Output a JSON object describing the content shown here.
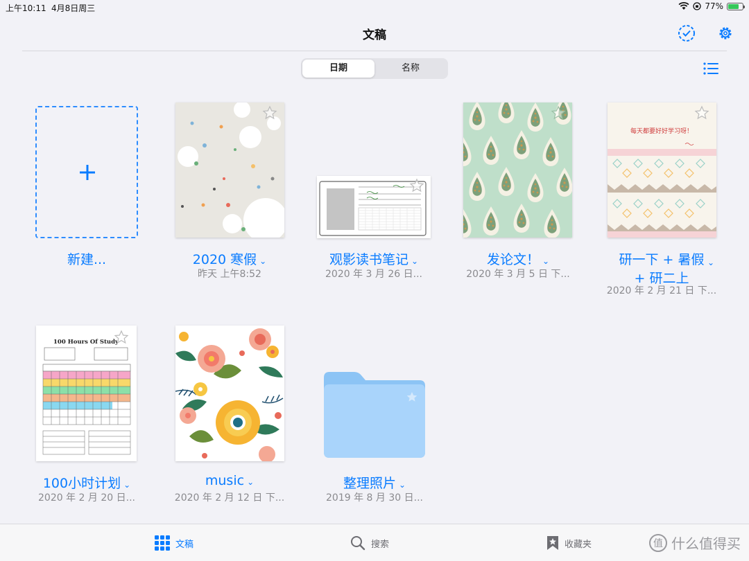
{
  "status": {
    "time": "上午10:11",
    "date": "4月8日周三",
    "battery": "77%",
    "battery_level": 0.77
  },
  "nav": {
    "title": "文稿"
  },
  "sort": {
    "options": [
      "日期",
      "名称"
    ],
    "selected": "日期"
  },
  "new_item": {
    "label": "新建..."
  },
  "documents": [
    {
      "name": "2020 寒假",
      "date": "昨天 上午8:52"
    },
    {
      "name": "观影读书笔记",
      "date": "2020 年 3 月 26 日..."
    },
    {
      "name": "发论文！",
      "date": "2020 年 3 月 5 日 下..."
    },
    {
      "name_line1": "研一下 + 暑假",
      "name_line2": "+ 研二上",
      "date": "2020 年 2 月 21 日 下..."
    },
    {
      "name": "100小时计划",
      "date": "2020 年 2 月 20 日...",
      "thumb_title": "100 Hours Of Study"
    },
    {
      "name": "music",
      "date": "2020 年 2 月 12 日 下..."
    },
    {
      "name": "整理照片",
      "date": "2019 年 8 月 30 日..."
    }
  ],
  "thumb_text": {
    "notes_cover": "每天都要好好学习呀！"
  },
  "tabs": [
    {
      "label": "文稿",
      "icon": "grid-icon"
    },
    {
      "label": "搜索",
      "icon": "search-icon"
    },
    {
      "label": "收藏夹",
      "icon": "bookmark-star-icon"
    }
  ],
  "watermark": {
    "text": "什么值得买",
    "badge": "值"
  },
  "colors": {
    "accent": "#0a7cff",
    "folder": "#a9d4fb"
  }
}
